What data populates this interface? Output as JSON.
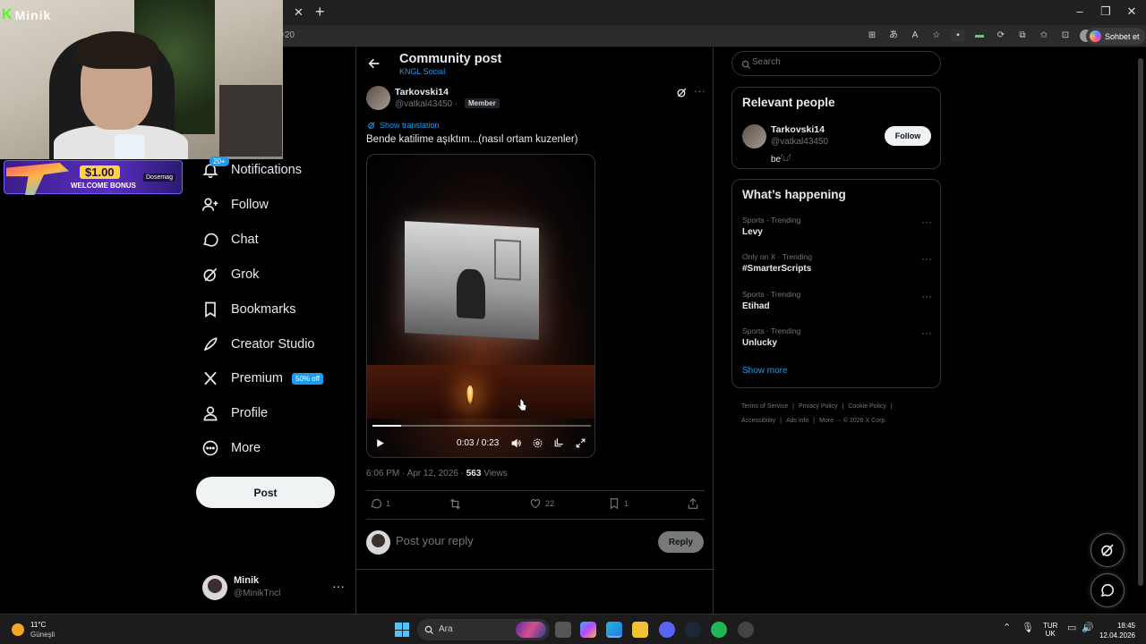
{
  "browser": {
    "address_fragment": "=20",
    "copilot_label": "Sohbet et"
  },
  "overlay": {
    "brand": "Minik",
    "promo_amount": "$1.00",
    "promo_label": "WELCOME BONUS",
    "promo_brand": "Dosemag"
  },
  "nav": {
    "notifications_badge": "20+",
    "items": [
      {
        "label": "Notifications",
        "icon": "bell-icon"
      },
      {
        "label": "Follow",
        "icon": "person-add-icon"
      },
      {
        "label": "Chat",
        "icon": "chat-icon"
      },
      {
        "label": "Grok",
        "icon": "grok-icon"
      },
      {
        "label": "Bookmarks",
        "icon": "bookmark-icon"
      },
      {
        "label": "Creator Studio",
        "icon": "rocket-icon"
      },
      {
        "label": "Premium",
        "icon": "x-logo-icon"
      },
      {
        "label": "Profile",
        "icon": "person-icon"
      },
      {
        "label": "More",
        "icon": "more-circle-icon"
      }
    ],
    "premium_badge": "50% off",
    "post_button": "Post",
    "account": {
      "name": "Minik",
      "handle": "@MinikTncl",
      "more": "···"
    }
  },
  "main": {
    "title": "Community post",
    "subtitle": "KNGL Social",
    "post": {
      "author": "Tarkovski14",
      "handle": "@vatkal43450",
      "handle_sep": "·",
      "badge": "Member",
      "show_translation": "Show translation",
      "text": "Bende katilime aşıktım...(nasıl ortam kuzenler)",
      "video": {
        "time": "0:03 / 0:23",
        "progress": 0.13
      },
      "timestamp": "6:06 PM · Apr 12, 2026 · ",
      "views_count": "563",
      "views_label": " Views",
      "replies": "1",
      "reposts": "",
      "likes": "22",
      "bookmarks": "1"
    },
    "reply": {
      "placeholder": "Post your reply",
      "button": "Reply"
    }
  },
  "sidebar": {
    "search_placeholder": "Search",
    "relevant": {
      "title": "Relevant people",
      "name": "Tarkovski14",
      "handle": "@vatkal43450",
      "bio": "be𓆩𓆪",
      "follow": "Follow"
    },
    "happening": {
      "title": "What’s happening",
      "trends": [
        {
          "context": "Sports · Trending",
          "name": "Levy"
        },
        {
          "context": "Only on X · Trending",
          "name": "#SmarterScripts"
        },
        {
          "context": "Sports · Trending",
          "name": "Etihad"
        },
        {
          "context": "Sports · Trending",
          "name": "Unlucky"
        }
      ],
      "show_more": "Show more"
    },
    "footer": {
      "terms": "Terms of Service",
      "privacy": "Privacy Policy",
      "cookie": "Cookie Policy",
      "accessibility": "Accessibility",
      "ads": "Ads info",
      "more": "More ···",
      "copyright": "© 2026 X Corp."
    }
  },
  "taskbar": {
    "temperature": "11°C",
    "weather": "Güneşli",
    "search": "Ara",
    "lang_top": "TUR",
    "lang_bottom": "UK",
    "time": "18:45",
    "date": "12.04.2026"
  },
  "colors": {
    "accent": "#1d9bf0",
    "background": "#000000",
    "border": "#2f3336",
    "muted": "#71767b"
  }
}
